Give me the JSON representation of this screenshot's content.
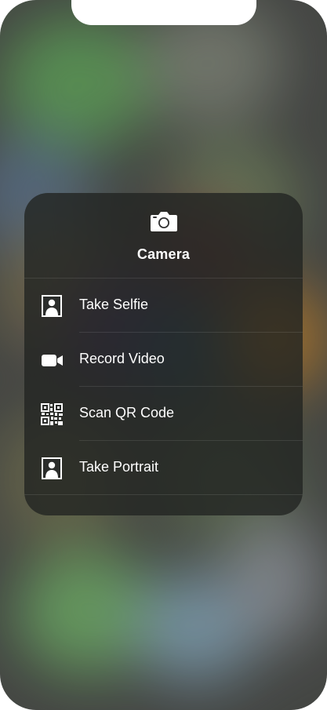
{
  "menu": {
    "title": "Camera",
    "header_icon": "camera-icon",
    "items": [
      {
        "label": "Take Selfie",
        "icon": "selfie-portrait-icon"
      },
      {
        "label": "Record Video",
        "icon": "video-camera-icon"
      },
      {
        "label": "Scan QR Code",
        "icon": "qr-code-icon"
      },
      {
        "label": "Take Portrait",
        "icon": "portrait-icon"
      }
    ]
  },
  "colors": {
    "menu_background": "#222422",
    "text": "#ffffff",
    "notch": "#ffffff"
  }
}
